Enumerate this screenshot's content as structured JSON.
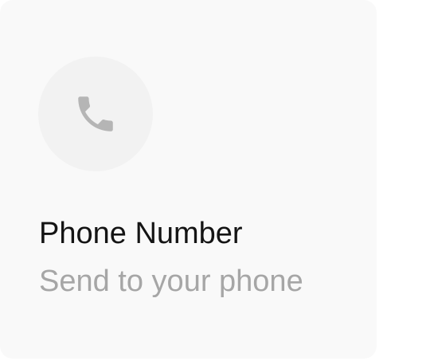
{
  "card": {
    "title": "Phone Number",
    "subtitle": "Send to your phone",
    "icon": "phone-icon",
    "colors": {
      "card_background": "#f9f9f9",
      "icon_circle": "#f2f2f2",
      "icon": "#b5b5b5",
      "title": "#141414",
      "subtitle": "#a6a6a6"
    }
  }
}
